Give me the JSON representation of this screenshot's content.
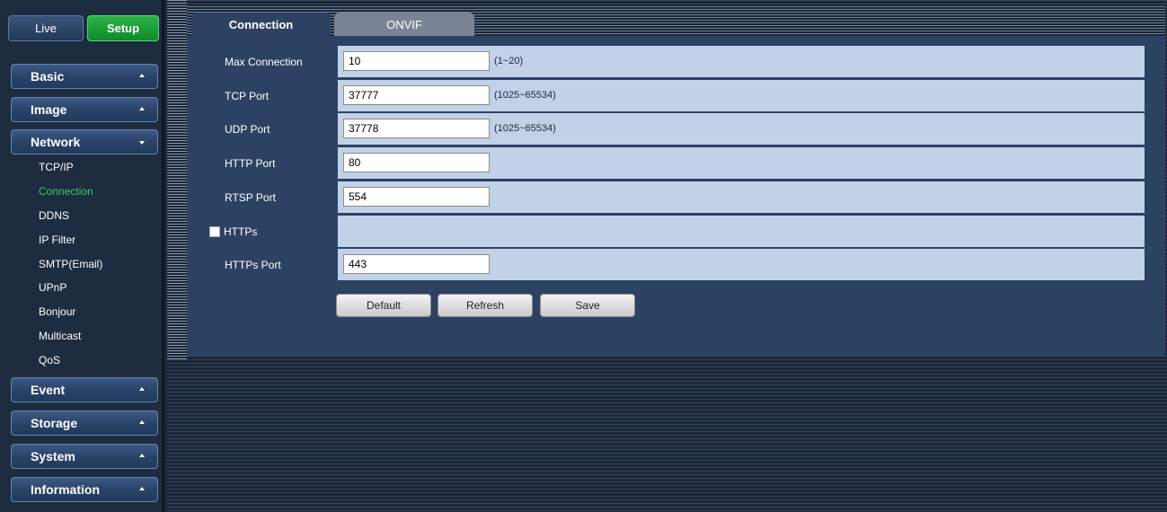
{
  "header": {
    "live_label": "Live",
    "setup_label": "Setup"
  },
  "sidebar": {
    "menus": [
      {
        "label": "Basic",
        "state": "collapsed"
      },
      {
        "label": "Image",
        "state": "collapsed"
      },
      {
        "label": "Network",
        "state": "expanded"
      },
      {
        "label": "Event",
        "state": "collapsed"
      },
      {
        "label": "Storage",
        "state": "collapsed"
      },
      {
        "label": "System",
        "state": "collapsed"
      },
      {
        "label": "Information",
        "state": "collapsed"
      }
    ],
    "network_items": [
      {
        "label": "TCP/IP"
      },
      {
        "label": "Connection",
        "active": true
      },
      {
        "label": "DDNS"
      },
      {
        "label": "IP Filter"
      },
      {
        "label": "SMTP(Email)"
      },
      {
        "label": "UPnP"
      },
      {
        "label": "Bonjour"
      },
      {
        "label": "Multicast"
      },
      {
        "label": "QoS"
      }
    ]
  },
  "tabs": [
    {
      "label": "Connection",
      "active": true
    },
    {
      "label": "ONVIF",
      "active": false
    }
  ],
  "form": {
    "max_connection": {
      "label": "Max Connection",
      "value": "10",
      "hint": "(1~20)"
    },
    "tcp_port": {
      "label": "TCP Port",
      "value": "37777",
      "hint": "(1025~65534)"
    },
    "udp_port": {
      "label": "UDP Port",
      "value": "37778",
      "hint": "(1025~65534)"
    },
    "http_port": {
      "label": "HTTP Port",
      "value": "80"
    },
    "rtsp_port": {
      "label": "RTSP Port",
      "value": "554"
    },
    "https": {
      "label": "HTTPs",
      "checked": false
    },
    "https_port": {
      "label": "HTTPs Port",
      "value": "443"
    }
  },
  "buttons": {
    "default_label": "Default",
    "refresh_label": "Refresh",
    "save_label": "Save"
  },
  "colors": {
    "active_menu_item": "#2fd05a",
    "setup_button": "#1ea33c",
    "panel_bg": "#2d4263",
    "row_bg": "#c1d2e8"
  }
}
